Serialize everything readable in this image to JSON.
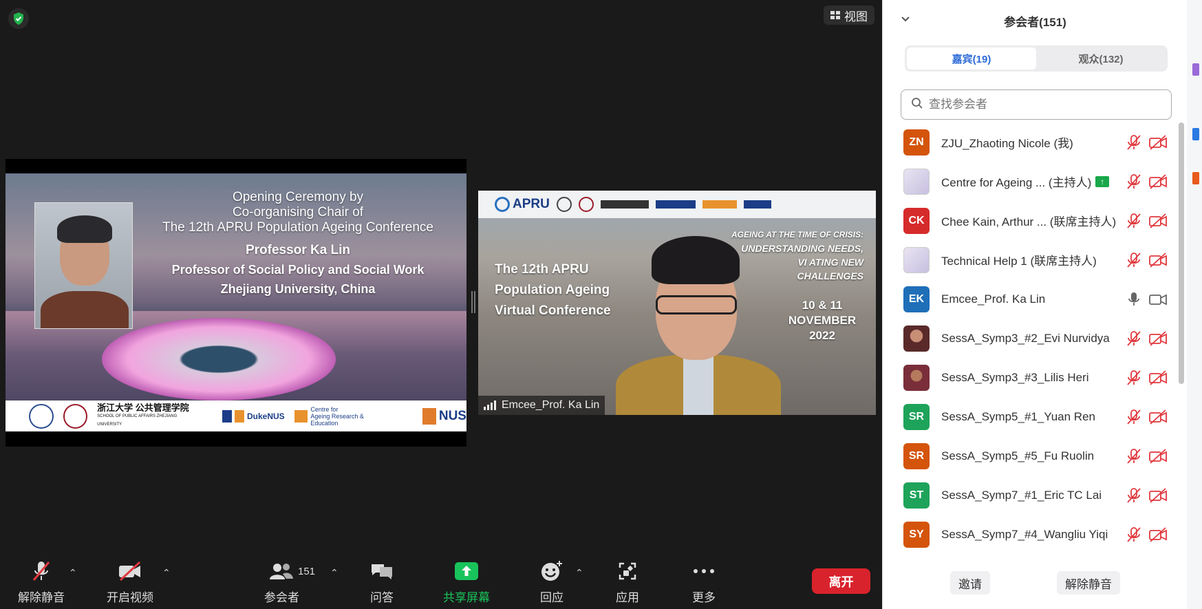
{
  "meeting": {
    "view_label": "视图",
    "slide": {
      "line1": "Opening Ceremony by",
      "line2": "Co-organising Chair of",
      "line3": "The 12th APRU Population Ageing Conference",
      "name": "Professor Ka Lin",
      "title": "Professor of Social Policy and Social Work",
      "affiliation": "Zhejiang University, China",
      "logo_zju": "浙江大学 公共管理学院",
      "logo_zju_sub": "SCHOOL OF PUBLIC AFFAIRS ZHEJIANG UNIVERSITY",
      "logo_duke": "DukeNUS",
      "logo_care_1": "Centre for",
      "logo_care_2": "Ageing Research & Education",
      "logo_nus": "NUS"
    },
    "speaker": {
      "apru": "APRU",
      "left_line1": "The 12th APRU",
      "left_line2": "Population Ageing",
      "left_line3": "Virtual Conference",
      "right_line1": "AGEING AT THE TIME OF CRISIS:",
      "right_line2": "UNDERSTANDING NEEDS,",
      "right_line3": "VI      ATING NEW",
      "right_line4": "CHALLENGES",
      "date1": "10 & 11",
      "date2": "NOVEMBER",
      "date3": "2022",
      "name_tag": "Emcee_Prof. Ka Lin"
    }
  },
  "toolbar": {
    "unmute": "解除静音",
    "start_video": "开启视频",
    "participants": "参会者",
    "participant_count": "151",
    "qa": "问答",
    "share": "共享屏幕",
    "reactions": "回应",
    "apps": "应用",
    "more": "更多",
    "leave": "离开"
  },
  "panel": {
    "title": "参会者(151)",
    "tab_panelists": "嘉宾(19)",
    "tab_attendees": "观众(132)",
    "search_placeholder": "查找参会者",
    "participants": [
      {
        "initials": "ZN",
        "color": "#d4540b",
        "name": "ZJU_Zhaoting Nicole (我)",
        "muted": true
      },
      {
        "initials": "",
        "color": "",
        "name": "Centre for Ageing ... (主持人)",
        "muted": true,
        "sharing": true
      },
      {
        "initials": "CK",
        "color": "#d62b2b",
        "name": "Chee Kain, Arthur ... (联席主持人)",
        "muted": true
      },
      {
        "initials": "",
        "color": "",
        "name": "Technical Help 1 (联席主持人)",
        "muted": true
      },
      {
        "initials": "EK",
        "color": "#1f6fb8",
        "name": "Emcee_Prof. Ka Lin",
        "muted": false
      },
      {
        "initials": "",
        "color": "",
        "name": "SessA_Symp3_#2_Evi Nurvidya",
        "muted": true
      },
      {
        "initials": "",
        "color": "",
        "name": "SessA_Symp3_#3_Lilis Heri",
        "muted": true
      },
      {
        "initials": "SR",
        "color": "#1ea35a",
        "name": "SessA_Symp5_#1_Yuan Ren",
        "muted": true
      },
      {
        "initials": "SR",
        "color": "#d4540b",
        "name": "SessA_Symp5_#5_Fu Ruolin",
        "muted": true
      },
      {
        "initials": "ST",
        "color": "#1ea35a",
        "name": "SessA_Symp7_#1_Eric TC Lai",
        "muted": true
      },
      {
        "initials": "SY",
        "color": "#d4540b",
        "name": "SessA_Symp7_#4_Wangliu Yiqi",
        "muted": true
      }
    ],
    "invite": "邀请",
    "unmute_all": "解除静音"
  }
}
